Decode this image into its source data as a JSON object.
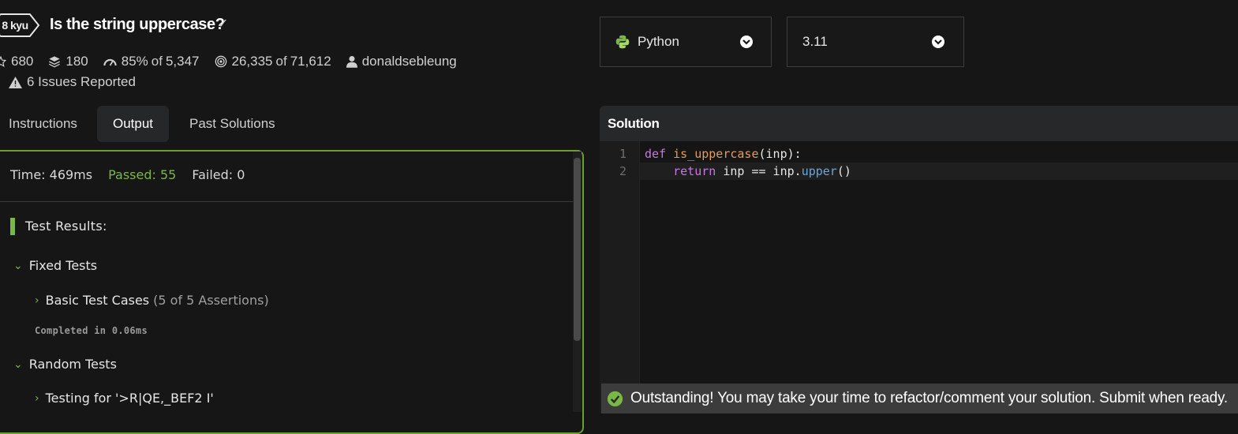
{
  "kata": {
    "rank": "8 kyu",
    "title": "Is the string uppercase?",
    "stats": {
      "stars": "680",
      "collections": "180",
      "satisfaction_percent": "85%",
      "satisfaction_of": "of",
      "satisfaction_votes": "5,347",
      "completions": "26,335",
      "completions_of": "of",
      "attempts": "71,612",
      "author": "donaldsebleung"
    },
    "issues": "6 Issues Reported"
  },
  "tabs": [
    {
      "label": "Instructions",
      "active": false
    },
    {
      "label": "Output",
      "active": true
    },
    {
      "label": "Past Solutions",
      "active": false
    }
  ],
  "output": {
    "time": "Time: 469ms",
    "passed": "Passed: 55",
    "failed": "Failed: 0",
    "results_label": "Test Results:",
    "fixed_tests": "Fixed Tests",
    "basic_test_cases": "Basic Test Cases",
    "basic_assertions": "(5 of 5 Assertions)",
    "completed": "Completed in 0.06ms",
    "random_tests": "Random Tests",
    "testing_for": "Testing for '>R|QE,_BEF2 I'"
  },
  "selectors": {
    "language": "Python",
    "version": "3.11"
  },
  "editor": {
    "title": "Solution",
    "lines": [
      {
        "number": "1",
        "kw": "def",
        "fn": "is_uppercase",
        "rest": "(inp):"
      },
      {
        "number": "2",
        "indent": "    ",
        "kw": "return",
        "pre": " inp == inp.",
        "meth": "upper",
        "post": "()"
      }
    ]
  },
  "banner": {
    "message": "Outstanding! You may take your time to refactor/comment your solution. Submit when ready."
  },
  "colors": {
    "accent_green": "#7ab648",
    "panel_border": "#6b9f34",
    "background": "#161616"
  }
}
